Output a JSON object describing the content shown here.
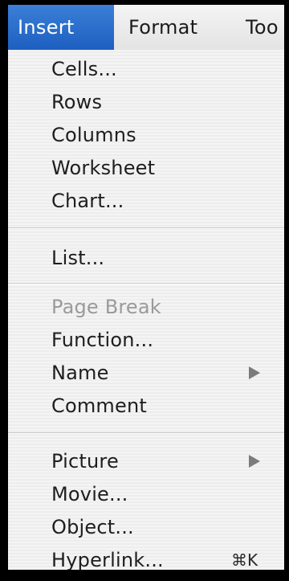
{
  "menubar": {
    "items": [
      {
        "label": "Insert",
        "active": true
      },
      {
        "label": "Format",
        "active": false
      },
      {
        "label": "Too",
        "active": false
      }
    ]
  },
  "menu": {
    "groups": [
      {
        "items": [
          {
            "label": "Cells..."
          },
          {
            "label": "Rows"
          },
          {
            "label": "Columns"
          },
          {
            "label": "Worksheet"
          },
          {
            "label": "Chart..."
          }
        ]
      },
      {
        "items": [
          {
            "label": "List..."
          }
        ]
      },
      {
        "items": [
          {
            "label": "Page Break",
            "disabled": true
          },
          {
            "label": "Function..."
          },
          {
            "label": "Name",
            "submenu": true
          },
          {
            "label": "Comment"
          }
        ]
      },
      {
        "items": [
          {
            "label": "Picture",
            "submenu": true
          },
          {
            "label": "Movie..."
          },
          {
            "label": "Object..."
          },
          {
            "label": "Hyperlink...",
            "shortcut": "⌘K"
          }
        ]
      }
    ]
  },
  "colors": {
    "active_menubar": "#2a6ccc",
    "disabled_text": "#9a9a9a",
    "text": "#1e1e1e"
  }
}
